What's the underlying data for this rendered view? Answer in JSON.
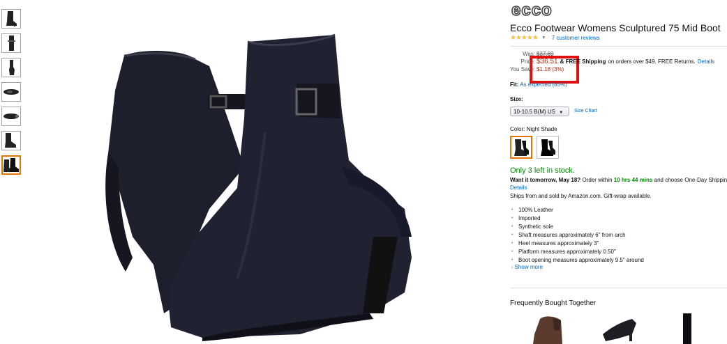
{
  "product": {
    "brand_logo": "ecco",
    "title": "Ecco Footwear Womens Sculptured 75 Mid Boot",
    "rating_icon": "five-stars",
    "review_link": "7 customer reviews"
  },
  "pricing": {
    "was_label": "Was:",
    "was_value": "$37.69",
    "price_label": "Price:",
    "price_value": "$36.51",
    "shipping_text": "& FREE Shipping",
    "shipping_condition": "on orders over $49. FREE Returns.",
    "details_link": "Details",
    "save_label": "You Save:",
    "save_value": "$1.18 (3%)"
  },
  "fit": {
    "label": "Fit:",
    "value": "As expected (85%)"
  },
  "size": {
    "label": "Size:",
    "selected": "10-10.5 B(M) US",
    "chart_link": "Size Chart"
  },
  "color": {
    "label": "Color:",
    "selected": "Night Shade"
  },
  "availability": {
    "stock": "Only 3 left in stock.",
    "want_it": "Want it tomorrow, May 18?",
    "order_within": "Order within",
    "time_left": "10 hrs 44 mins",
    "choose": "and choose One-Day Shipping at checkout.",
    "details_link": "Details",
    "ships_from": "Ships from and sold by Amazon.com. Gift-wrap available."
  },
  "features": [
    "100% Leather",
    "Imported",
    "Synthetic sole",
    "Shaft measures approximately 6\" from arch",
    "Heel measures approximately 3\"",
    "Platform measures approximately 0.50\"",
    "Boot opening measures approximately 9.5\" around"
  ],
  "show_more": "Show more",
  "frequently_bought": "Frequently Bought Together",
  "colors": {
    "price_red": "#b12704",
    "link_blue": "#0066c0",
    "stock_green": "#008a00",
    "selection_orange": "#e77600",
    "highlight_red": "#e01010",
    "star_gold": "#f0c14b"
  }
}
